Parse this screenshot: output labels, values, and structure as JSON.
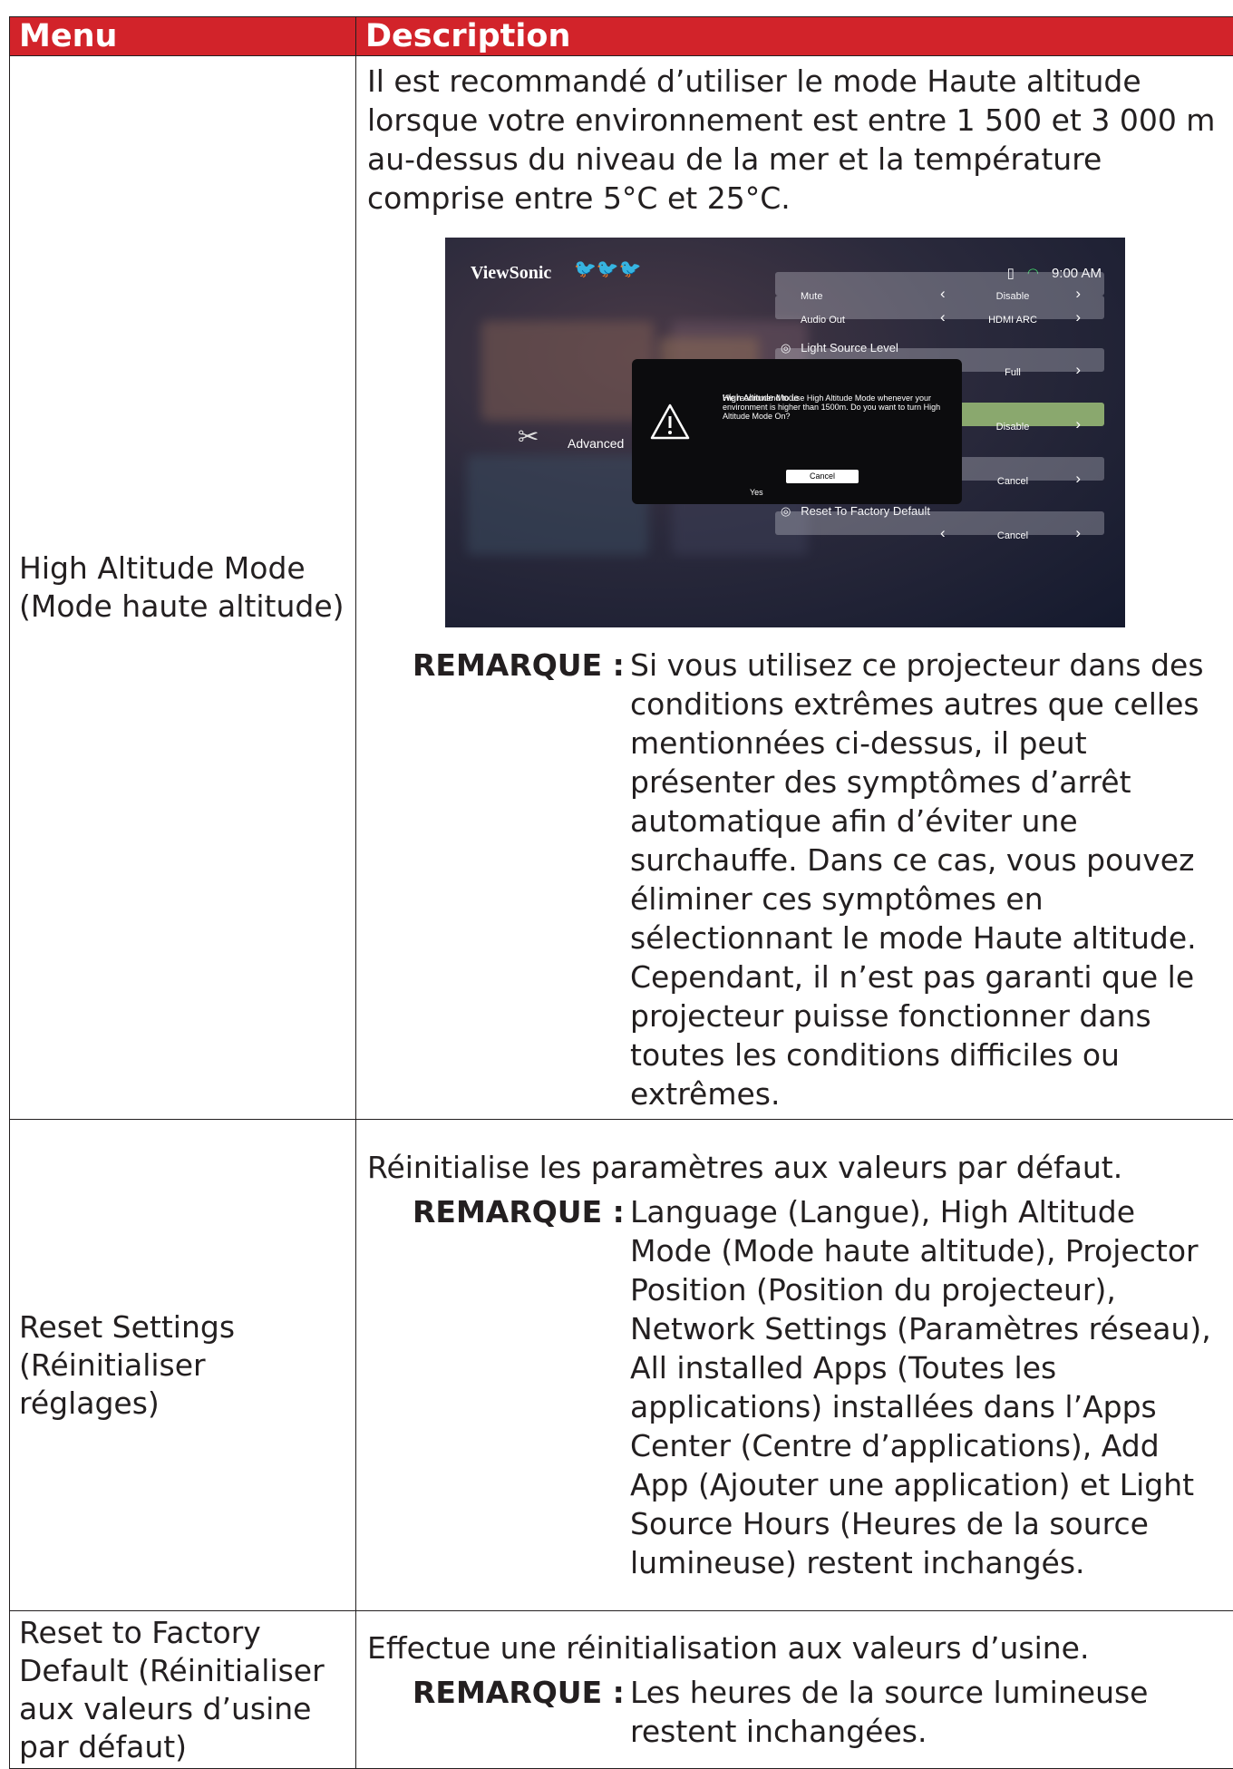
{
  "table": {
    "header": {
      "menu": "Menu",
      "description": "Description"
    },
    "rows": [
      {
        "menu": "High Altitude Mode (Mode haute altitude)",
        "intro": "Il est recommandé d’utiliser le mode Haute altitude lorsque votre environnement est entre 1 500 et 3 000 m au-dessus du niveau de la mer et la température comprise entre 5°C et 25°C.",
        "note_label": "REMARQUE :",
        "note": "Si vous utilisez ce projecteur dans des conditions extrêmes autres que celles mentionnées ci-dessus, il peut présenter des symptômes d’arrêt automatique afin d’éviter une surchauffe. Dans ce cas, vous pouvez éliminer ces symptômes en sélectionnant le mode Haute altitude. Cependant, il n’est pas garanti que le projecteur puisse fonctionner dans toutes les conditions difficiles ou extrêmes."
      },
      {
        "menu": "Reset Settings (Réinitialiser réglages)",
        "intro": "Réinitialise les paramètres aux valeurs par défaut.",
        "note_label": "REMARQUE :",
        "note": "Language (Langue), High Altitude Mode (Mode haute altitude), Projector Position (Position du projecteur), Network Settings (Paramètres réseau), All installed Apps (Toutes les applications) installées dans l’Apps Center (Centre d’applications), Add App (Ajouter une application) et Light Source Hours (Heures de la source lumineuse) restent inchangés."
      },
      {
        "menu": "Reset to Factory Default (Réinitialiser aux valeurs d’usine par défaut)",
        "intro": "Effectue une réinitialisation aux valeurs d’usine.",
        "note_label": "REMARQUE :",
        "note": "Les heures de la source lumineuse restent inchangées."
      }
    ]
  },
  "screenshot": {
    "brand": "ViewSonic",
    "time": "9:00 AM",
    "rows": [
      {
        "name": "Mute",
        "value": "Disable"
      },
      {
        "name": "Audio Out",
        "value": "HDMI ARC"
      },
      {
        "name": "",
        "value": "Full"
      },
      {
        "name": "",
        "value": "Disable"
      },
      {
        "name": "",
        "value": "Cancel"
      },
      {
        "name": "",
        "value": "Cancel"
      }
    ],
    "light_source_label": "Light Source Level",
    "reset_label": "Reset To Factory Default",
    "advanced_label": "Advanced",
    "dialog": {
      "title": "High Altitude Mode",
      "body": "We recommend to use High Altitude Mode whenever your\n environment is higher than 1500m. Do you want to turn High\n Altitude Mode On?",
      "yes": "Yes",
      "cancel": "Cancel"
    },
    "colors": {
      "highlight": "#8aa86e",
      "header": "#d2232a"
    }
  }
}
